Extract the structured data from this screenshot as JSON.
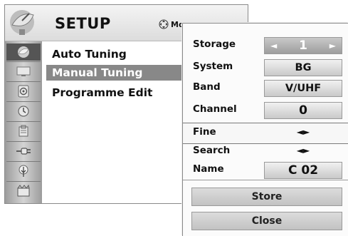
{
  "setup": {
    "title": "SETUP",
    "move_hint": "Mo",
    "icons": [
      "antenna-icon",
      "picture-icon",
      "audio-icon",
      "clock-icon",
      "lock-icon",
      "input-icon",
      "usb-icon",
      "media-icon"
    ],
    "items": [
      {
        "label": "Auto Tuning",
        "selected": false
      },
      {
        "label": "Manual Tuning",
        "selected": true
      },
      {
        "label": "Programme Edit",
        "selected": false
      }
    ]
  },
  "tuning": {
    "storage_label": "Storage",
    "storage_value": "1",
    "system_label": "System",
    "system_value": "BG",
    "band_label": "Band",
    "band_value": "V/UHF",
    "channel_label": "Channel",
    "channel_value": "0",
    "fine_label": "Fine",
    "fine_arrows": "◄►",
    "search_label": "Search",
    "search_arrows": "◄►",
    "name_label": "Name",
    "name_value": "C 02",
    "store_label": "Store",
    "close_label": "Close"
  },
  "colors": {
    "selected_row": "#888888",
    "active_field": "#a8a8a8",
    "button": "#cfcfcf"
  }
}
